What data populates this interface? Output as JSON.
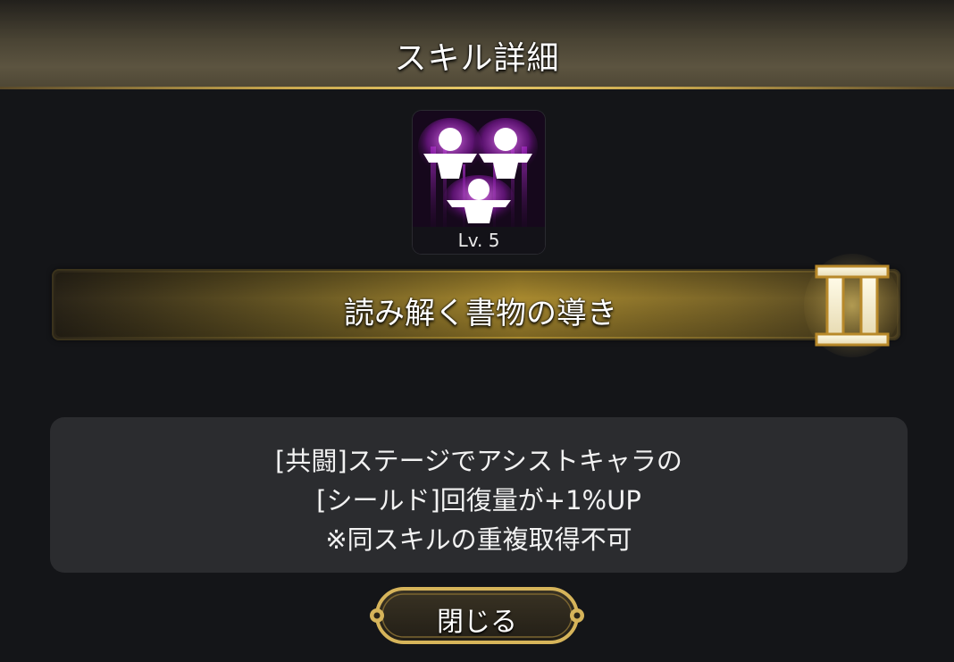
{
  "dialog": {
    "title": "スキル詳細"
  },
  "skill": {
    "icon": "triple-person-shield-icon",
    "level_label": "Lv. 5",
    "name": "読み解く書物の導き",
    "rank_label": "II"
  },
  "description": {
    "lines": [
      "[共闘]ステージでアシストキャラの",
      "[シールド]回復量が+1%UP",
      "※同スキルの重複取得不可"
    ]
  },
  "buttons": {
    "close_label": "閉じる"
  },
  "colors": {
    "accent_gold": "#c9a84e",
    "icon_glow": "#c040e0",
    "background": "#141518"
  }
}
